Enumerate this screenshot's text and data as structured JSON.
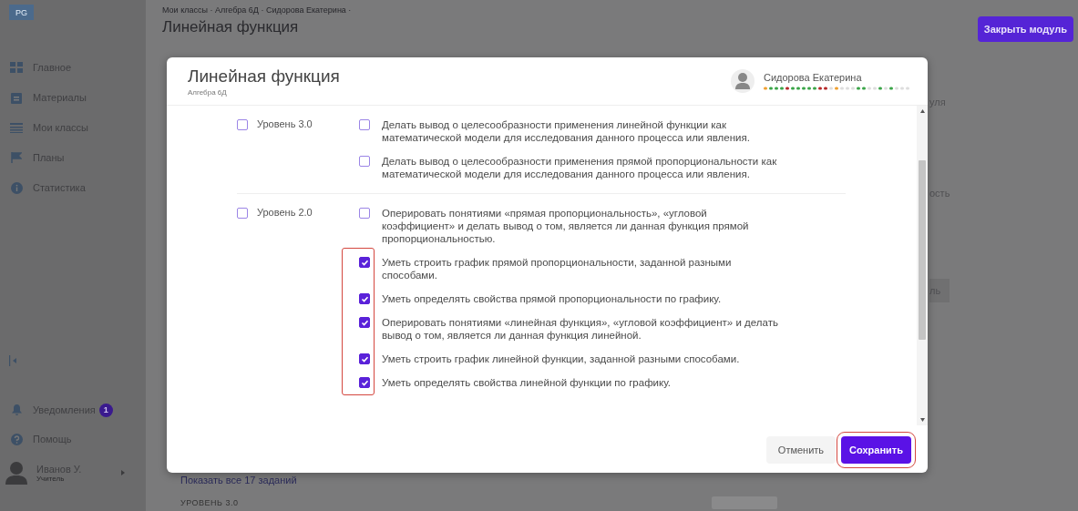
{
  "sidebar": {
    "logo": "PG",
    "items": [
      {
        "label": "Главное"
      },
      {
        "label": "Материалы"
      },
      {
        "label": "Мои классы"
      },
      {
        "label": "Планы"
      },
      {
        "label": "Статистика"
      }
    ],
    "notifications": {
      "label": "Уведомления",
      "badge": "1"
    },
    "help": {
      "label": "Помощь"
    },
    "user": {
      "name": "Иванов У.",
      "role": "Учитель"
    }
  },
  "page": {
    "breadcrumbs": "Мои классы · Алгебра 6Д · Сидорова Екатерина ·",
    "title": "Линейная функция",
    "close_button": "Закрыть модуль",
    "fragments": [
      "уля",
      "ость",
      "ль"
    ],
    "show_all_link": "Показать все 17 заданий",
    "level_heading": "УРОВЕНЬ 3.0"
  },
  "modal": {
    "title": "Линейная функция",
    "subtitle": "Алгебра 6Д",
    "student": "Сидорова Екатерина",
    "groups": [
      {
        "label": "Уровень 3.0",
        "checked": false,
        "items": [
          {
            "text": "Делать вывод о целесообразности применения линейной функции как математической модели для исследования данного процесса или явления.",
            "checked": false
          },
          {
            "text": "Делать вывод о целесообразности применения прямой пропорциональности как математической модели для исследования данного процесса или явления.",
            "checked": false
          }
        ]
      },
      {
        "label": "Уровень 2.0",
        "checked": false,
        "items": [
          {
            "text": "Оперировать понятиями «прямая пропорциональность», «угловой коэффициент» и делать вывод о том, является ли данная функция прямой пропорциональностью.",
            "checked": false
          },
          {
            "text": "Уметь строить график прямой пропорциональности, заданной разными способами.",
            "checked": true
          },
          {
            "text": "Уметь определять свойства прямой пропорциональности по графику.",
            "checked": true
          },
          {
            "text": "Оперировать понятиями «линейная функция», «угловой коэффициент» и делать вывод о том, является ли данная функция линейной.",
            "checked": true
          },
          {
            "text": "Уметь строить график линейной функции, заданной разными способами.",
            "checked": true
          },
          {
            "text": "Уметь определять свойства линейной функции по графику.",
            "checked": true
          }
        ]
      }
    ],
    "cancel_button": "Отменить",
    "save_button": "Сохранить"
  }
}
